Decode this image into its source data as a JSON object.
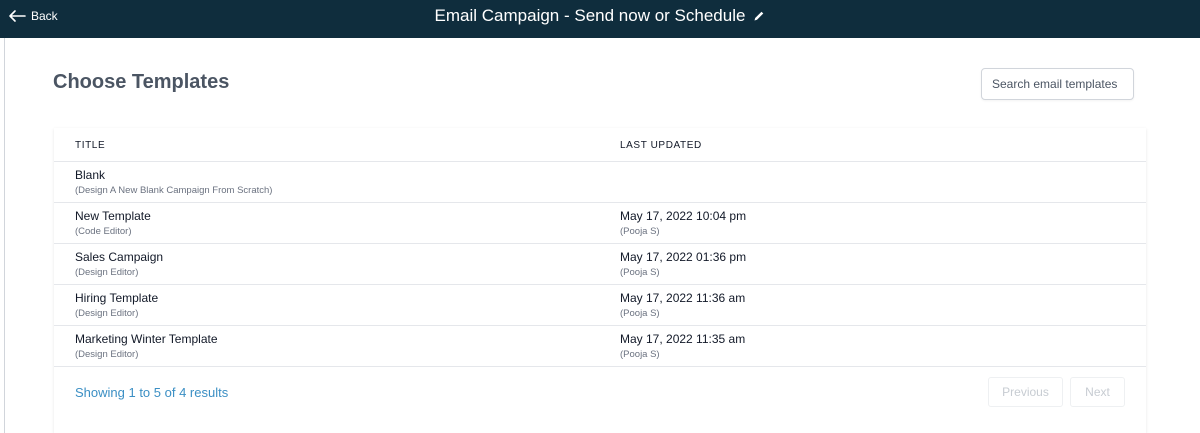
{
  "header": {
    "back_label": "Back",
    "title": "Email Campaign - Send now or Schedule",
    "back_icon": "arrow-left-icon",
    "edit_icon": "pencil-icon"
  },
  "page": {
    "heading": "Choose Templates",
    "search_placeholder": "Search email templates"
  },
  "table": {
    "columns": [
      "TITLE",
      "LAST UPDATED"
    ],
    "rows": [
      {
        "title": "Blank",
        "subtitle": "(Design A New Blank Campaign From Scratch)",
        "date": "",
        "author": ""
      },
      {
        "title": "New Template",
        "subtitle": "(Code Editor)",
        "date": "May 17, 2022 10:04 pm",
        "author": "(Pooja S)"
      },
      {
        "title": "Sales Campaign",
        "subtitle": "(Design Editor)",
        "date": "May 17, 2022 01:36 pm",
        "author": "(Pooja S)"
      },
      {
        "title": "Hiring Template",
        "subtitle": "(Design Editor)",
        "date": "May 17, 2022 11:36 am",
        "author": "(Pooja S)"
      },
      {
        "title": "Marketing Winter Template",
        "subtitle": "(Design Editor)",
        "date": "May 17, 2022 11:35 am",
        "author": "(Pooja S)"
      }
    ]
  },
  "pagination": {
    "summary": "Showing 1 to 5 of 4 results",
    "previous_label": "Previous",
    "next_label": "Next"
  },
  "colors": {
    "header_bg": "#0f2d3d",
    "link": "#3b8fc4"
  }
}
